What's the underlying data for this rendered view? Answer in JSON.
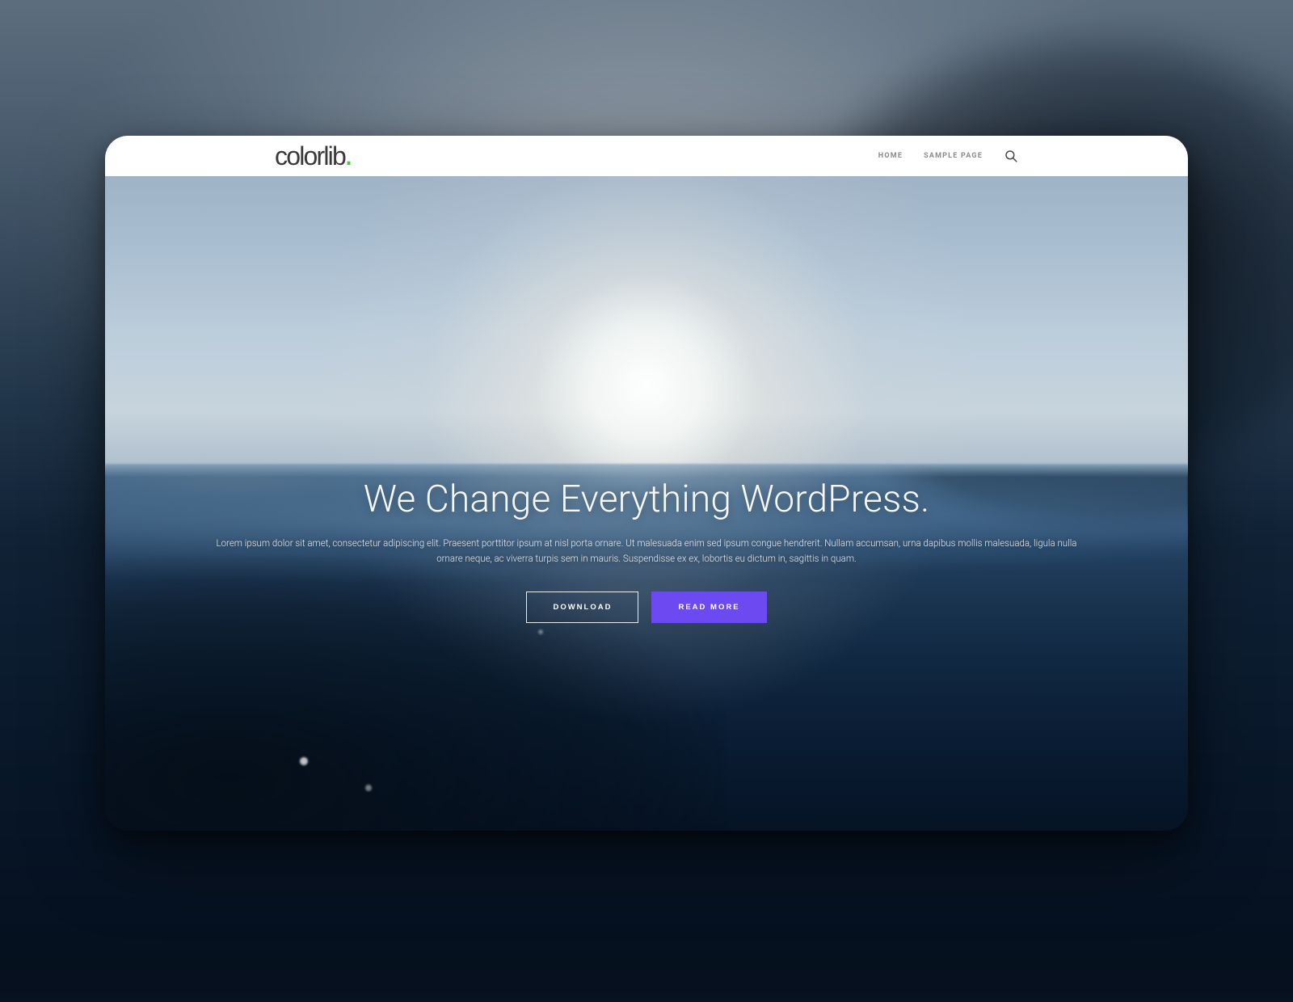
{
  "brand": {
    "name": "colorlib",
    "accent": "."
  },
  "nav": {
    "items": [
      {
        "label": "HOME"
      },
      {
        "label": "SAMPLE PAGE"
      }
    ]
  },
  "hero": {
    "title": "We Change Everything WordPress.",
    "subtitle": "Lorem ipsum dolor sit amet, consectetur adipiscing elit. Praesent porttitor ipsum at nisl porta ornare. Ut malesuada enim sed ipsum congue hendrerit. Nullam accumsan, urna dapibus mollis malesuada, ligula nulla ornare neque, ac viverra turpis sem in mauris. Suspendisse ex ex, lobortis eu dictum in, sagittis in quam.",
    "buttons": {
      "primary_outline": "DOWNLOAD",
      "primary_solid": "READ MORE"
    }
  },
  "colors": {
    "accent_purple": "#6c4af2",
    "logo_dot": "#47c64a"
  }
}
